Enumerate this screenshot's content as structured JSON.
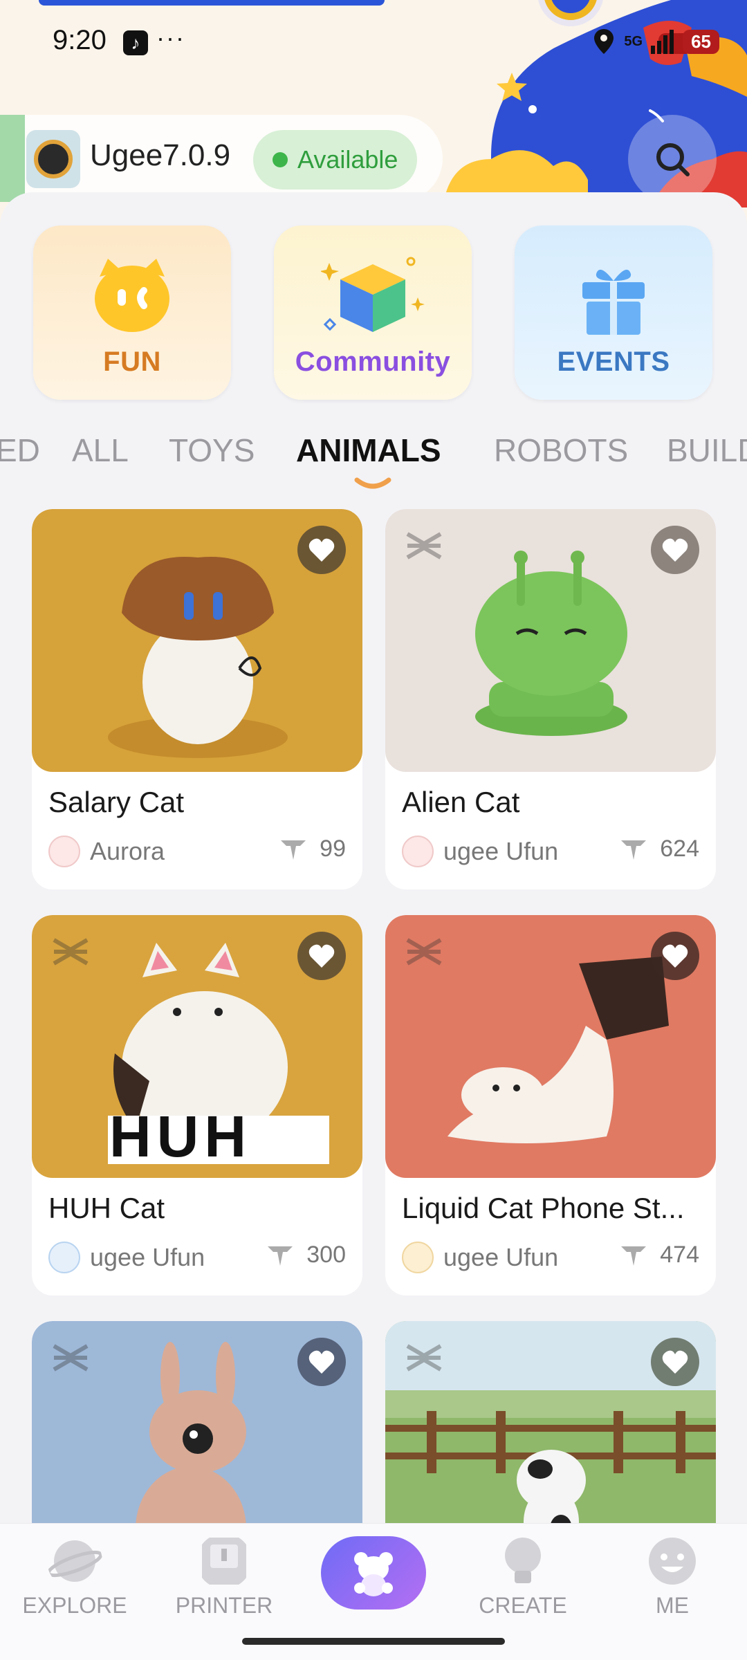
{
  "status_bar": {
    "time": "9:20",
    "dots": "···",
    "network": "5G",
    "battery": "65"
  },
  "printer": {
    "name": "Ugee7.0.9",
    "status": "Available"
  },
  "categories": [
    {
      "label": "FUN",
      "icon": "cat-face-icon"
    },
    {
      "label": "Community",
      "icon": "cube-icon"
    },
    {
      "label": "EVENTS",
      "icon": "gift-icon"
    }
  ],
  "tabs": [
    "ED",
    "ALL",
    "TOYS",
    "ANIMALS",
    "ROBOTS",
    "BUILD"
  ],
  "active_tab": "ANIMALS",
  "models": [
    {
      "title": "Salary Cat",
      "author": "Aurora",
      "downloads": "99",
      "bg": "#d6a23a"
    },
    {
      "title": "Alien Cat",
      "author": "ugee Ufun",
      "downloads": "624",
      "bg": "#e9e1dc"
    },
    {
      "title": "HUH Cat",
      "author": "ugee Ufun",
      "downloads": "300",
      "bg": "#d9a43e"
    },
    {
      "title": "Liquid Cat Phone St...",
      "author": "ugee Ufun",
      "downloads": "474",
      "bg": "#e07a63"
    },
    {
      "title": "",
      "author": "",
      "downloads": "",
      "bg": "#9eb8d8"
    },
    {
      "title": "",
      "author": "",
      "downloads": "",
      "bg": "#8fb86a"
    }
  ],
  "huh_text": "HUH",
  "nav": [
    {
      "label": "EXPLORE"
    },
    {
      "label": "PRINTER"
    },
    {
      "label": ""
    },
    {
      "label": "CREATE"
    },
    {
      "label": "ME"
    }
  ],
  "colors": {
    "accent_purple": "#8a4fe0",
    "tab_underline": "#f0a04b",
    "available_green": "#3eb54a"
  }
}
